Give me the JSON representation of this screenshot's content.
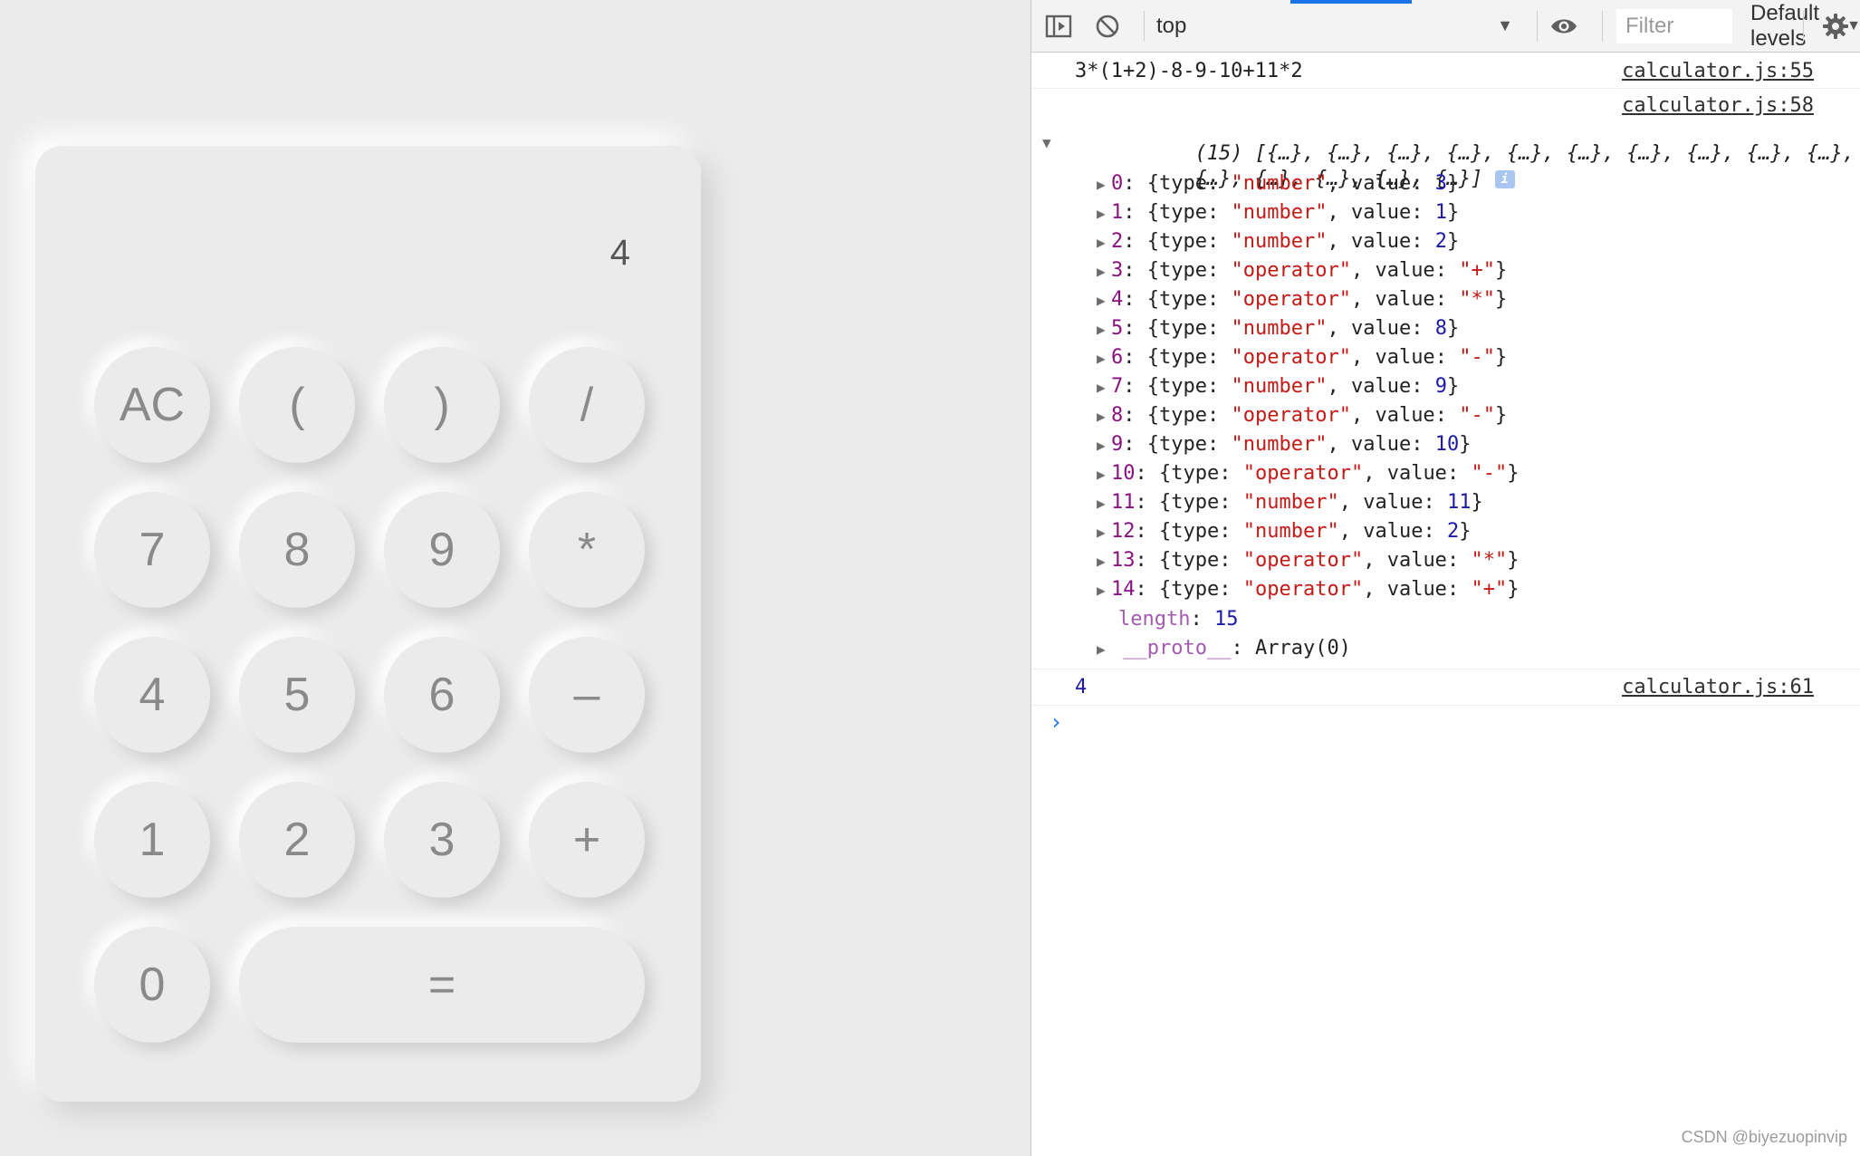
{
  "calculator": {
    "display": "4",
    "keys": {
      "ac": "AC",
      "lparen": "(",
      "rparen": ")",
      "divide": "/",
      "seven": "7",
      "eight": "8",
      "nine": "9",
      "multiply": "*",
      "four": "4",
      "five": "5",
      "six": "6",
      "minus": "–",
      "one": "1",
      "two": "2",
      "three": "3",
      "plus": "+",
      "zero": "0",
      "equals": "="
    }
  },
  "devtools": {
    "toolbar": {
      "context": "top",
      "filter_placeholder": "Filter",
      "levels": "Default levels",
      "icons": [
        "sidebar-toggle-icon",
        "clear-console-icon",
        "eye-icon",
        "gear-icon"
      ]
    },
    "console": {
      "log1": {
        "text": "3*(1+2)-8-9-10+11*2",
        "source": "calculator.js:55"
      },
      "log2": {
        "source": "calculator.js:58",
        "summary_line1": "(15) [{…}, {…}, {…}, {…}, {…}, {…}, {…}, {…}, {…}, {…},",
        "summary_line2": "{…}, {…}, {…}, {…}, {…}]",
        "info_badge": "i",
        "items": [
          {
            "index": "0",
            "type": "number",
            "value": "3"
          },
          {
            "index": "1",
            "type": "number",
            "value": "1"
          },
          {
            "index": "2",
            "type": "number",
            "value": "2"
          },
          {
            "index": "3",
            "type": "operator",
            "value": "+"
          },
          {
            "index": "4",
            "type": "operator",
            "value": "*"
          },
          {
            "index": "5",
            "type": "number",
            "value": "8"
          },
          {
            "index": "6",
            "type": "operator",
            "value": "-"
          },
          {
            "index": "7",
            "type": "number",
            "value": "9"
          },
          {
            "index": "8",
            "type": "operator",
            "value": "-"
          },
          {
            "index": "9",
            "type": "number",
            "value": "10"
          },
          {
            "index": "10",
            "type": "operator",
            "value": "-"
          },
          {
            "index": "11",
            "type": "number",
            "value": "11"
          },
          {
            "index": "12",
            "type": "number",
            "value": "2"
          },
          {
            "index": "13",
            "type": "operator",
            "value": "*"
          },
          {
            "index": "14",
            "type": "operator",
            "value": "+"
          }
        ],
        "length_label": "length",
        "length_value": "15",
        "proto_label": "__proto__",
        "proto_value": "Array(0)"
      },
      "log3": {
        "text": "4",
        "source": "calculator.js:61"
      },
      "prompt": "›"
    }
  },
  "watermark": "CSDN @biyezuopinvip",
  "colors": {
    "background": "#ebebeb",
    "accent": "#1a73e8",
    "string": "#c41a16",
    "number": "#1a1aa6",
    "index": "#881280"
  }
}
